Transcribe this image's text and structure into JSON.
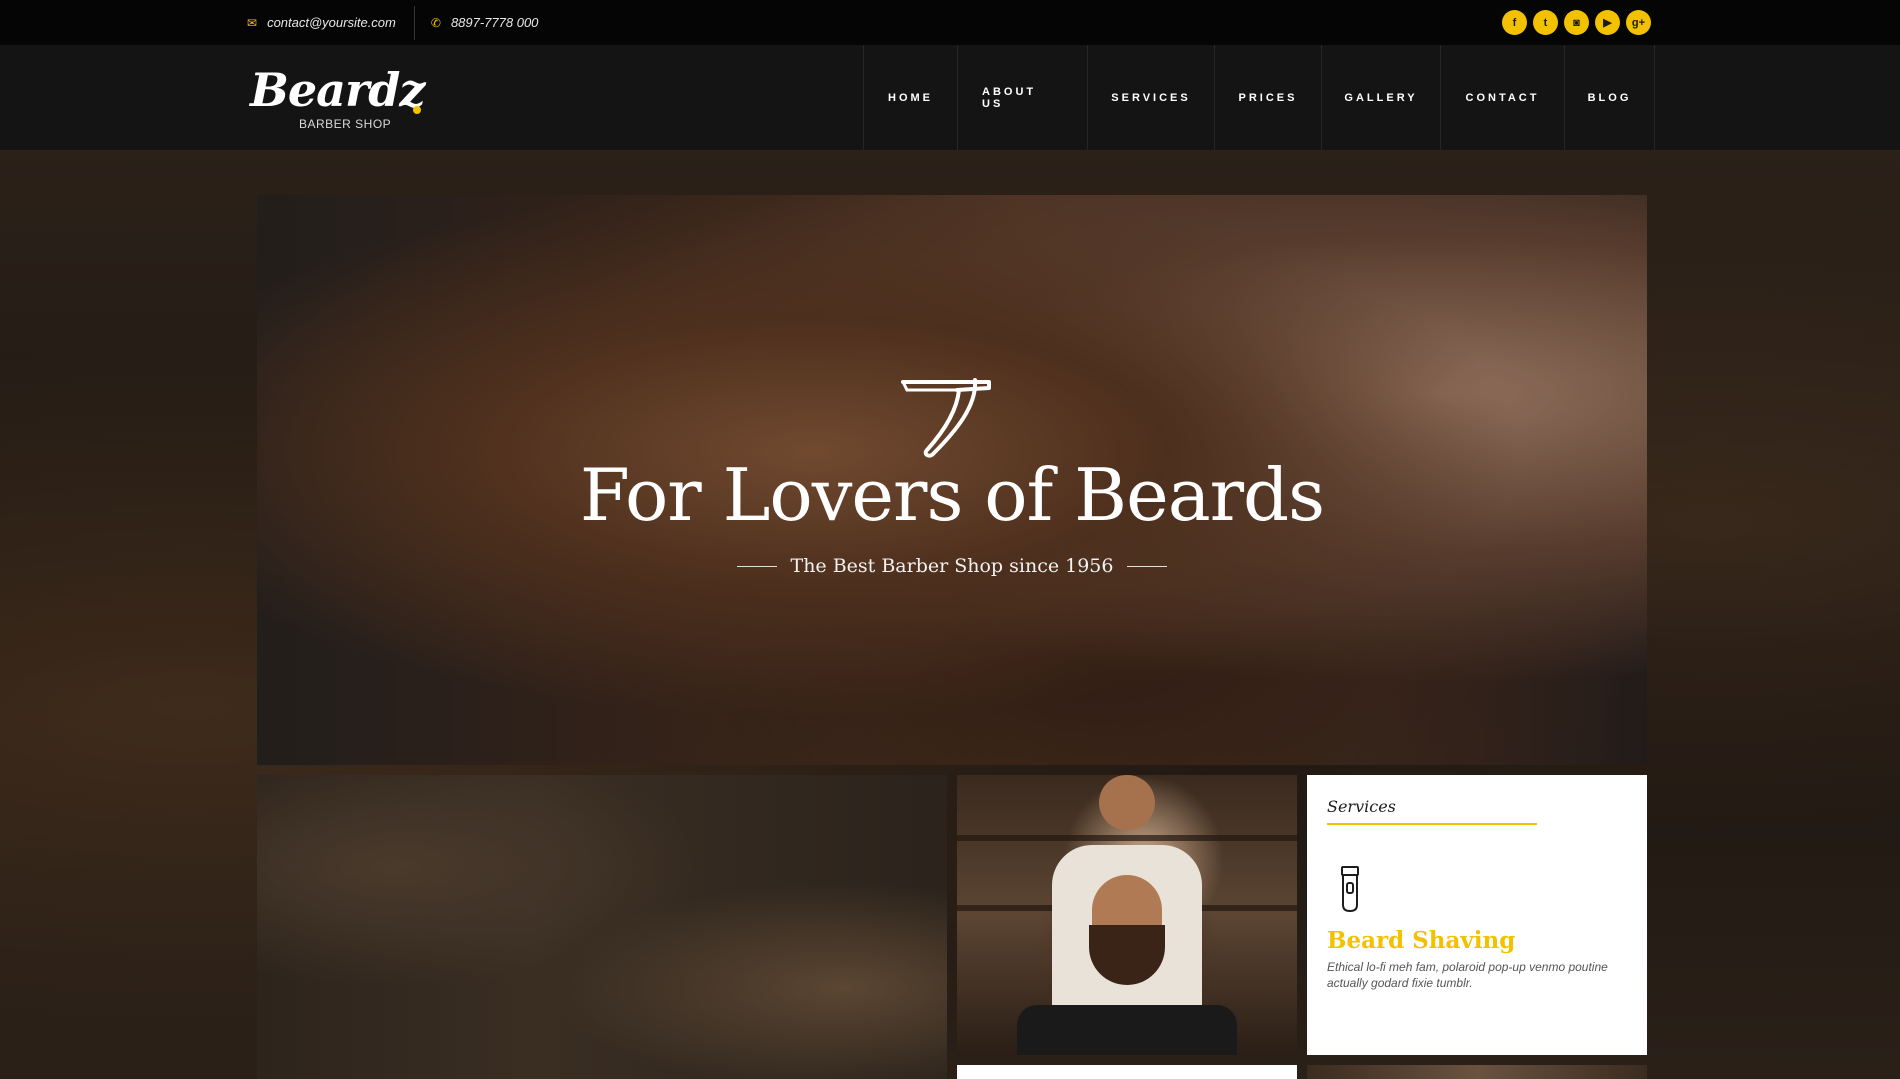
{
  "topbar": {
    "email": "contact@yoursite.com",
    "phone": "8897-7778 000",
    "socials": [
      {
        "name": "facebook-icon",
        "glyph": "f"
      },
      {
        "name": "twitter-icon",
        "glyph": "t"
      },
      {
        "name": "instagram-icon",
        "glyph": "◙"
      },
      {
        "name": "youtube-icon",
        "glyph": "▶"
      },
      {
        "name": "google-plus-icon",
        "glyph": "g+"
      }
    ]
  },
  "logo": {
    "main": "Beardz",
    "sub": "BARBER SHOP"
  },
  "nav": {
    "items": [
      "HOME",
      "ABOUT US",
      "SERVICES",
      "PRICES",
      "GALLERY",
      "CONTACT",
      "BLOG"
    ]
  },
  "hero": {
    "title": "For Lovers of Beards",
    "subtitle": "The Best Barber Shop since 1956"
  },
  "services": {
    "heading": "Services",
    "title": "Beard Shaving",
    "text": "Ethical lo-fi meh fam, polaroid pop-up venmo poutine actually godard fixie tumblr."
  },
  "colors": {
    "accent": "#f2c200",
    "topbar": "#050505",
    "header": "#141414"
  }
}
